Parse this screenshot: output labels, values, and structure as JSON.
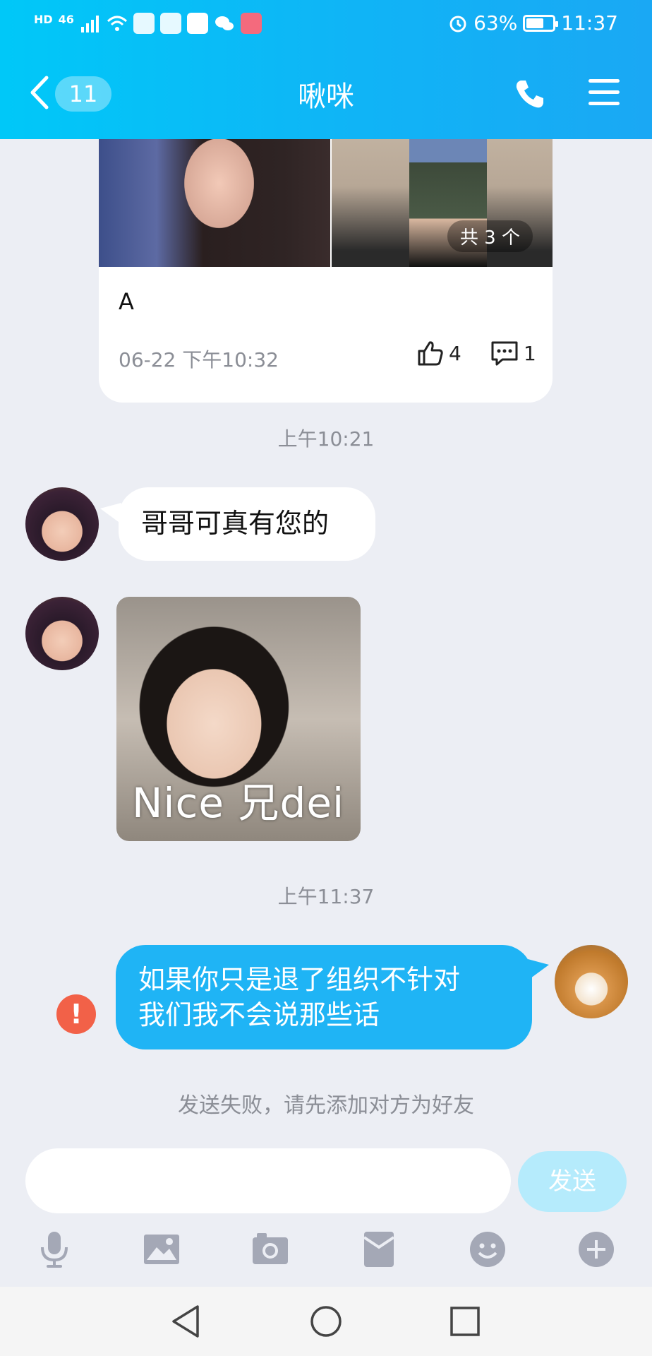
{
  "status_bar": {
    "network_tag": "46",
    "hd_tag": "HD",
    "battery": "63%",
    "time": "11:37"
  },
  "nav": {
    "unread_count": "11",
    "title": "啾咪"
  },
  "feed_card": {
    "photo_count": "共 3 个",
    "text": "A",
    "timestamp": "06-22 下午10:32",
    "likes": "4",
    "comments": "1"
  },
  "messages": {
    "time1": "上午10:21",
    "msg1": "哥哥可真有您的",
    "sticker_text": "Nice 兄dei",
    "time2": "上午11:37",
    "msg_out_line1": "如果你只是退了组织不针对",
    "msg_out_line2": "我们我不会说那些话",
    "error_mark": "!",
    "notice": "发送失败，请先添加对方为好友"
  },
  "composer": {
    "send_label": "发送",
    "input_value": ""
  },
  "colors": {
    "header_start": "#00c8f8",
    "header_end": "#1aa8f4",
    "outgoing_bubble": "#1fb4f5",
    "error": "#f26148",
    "send_disabled": "#b5ebfc"
  }
}
